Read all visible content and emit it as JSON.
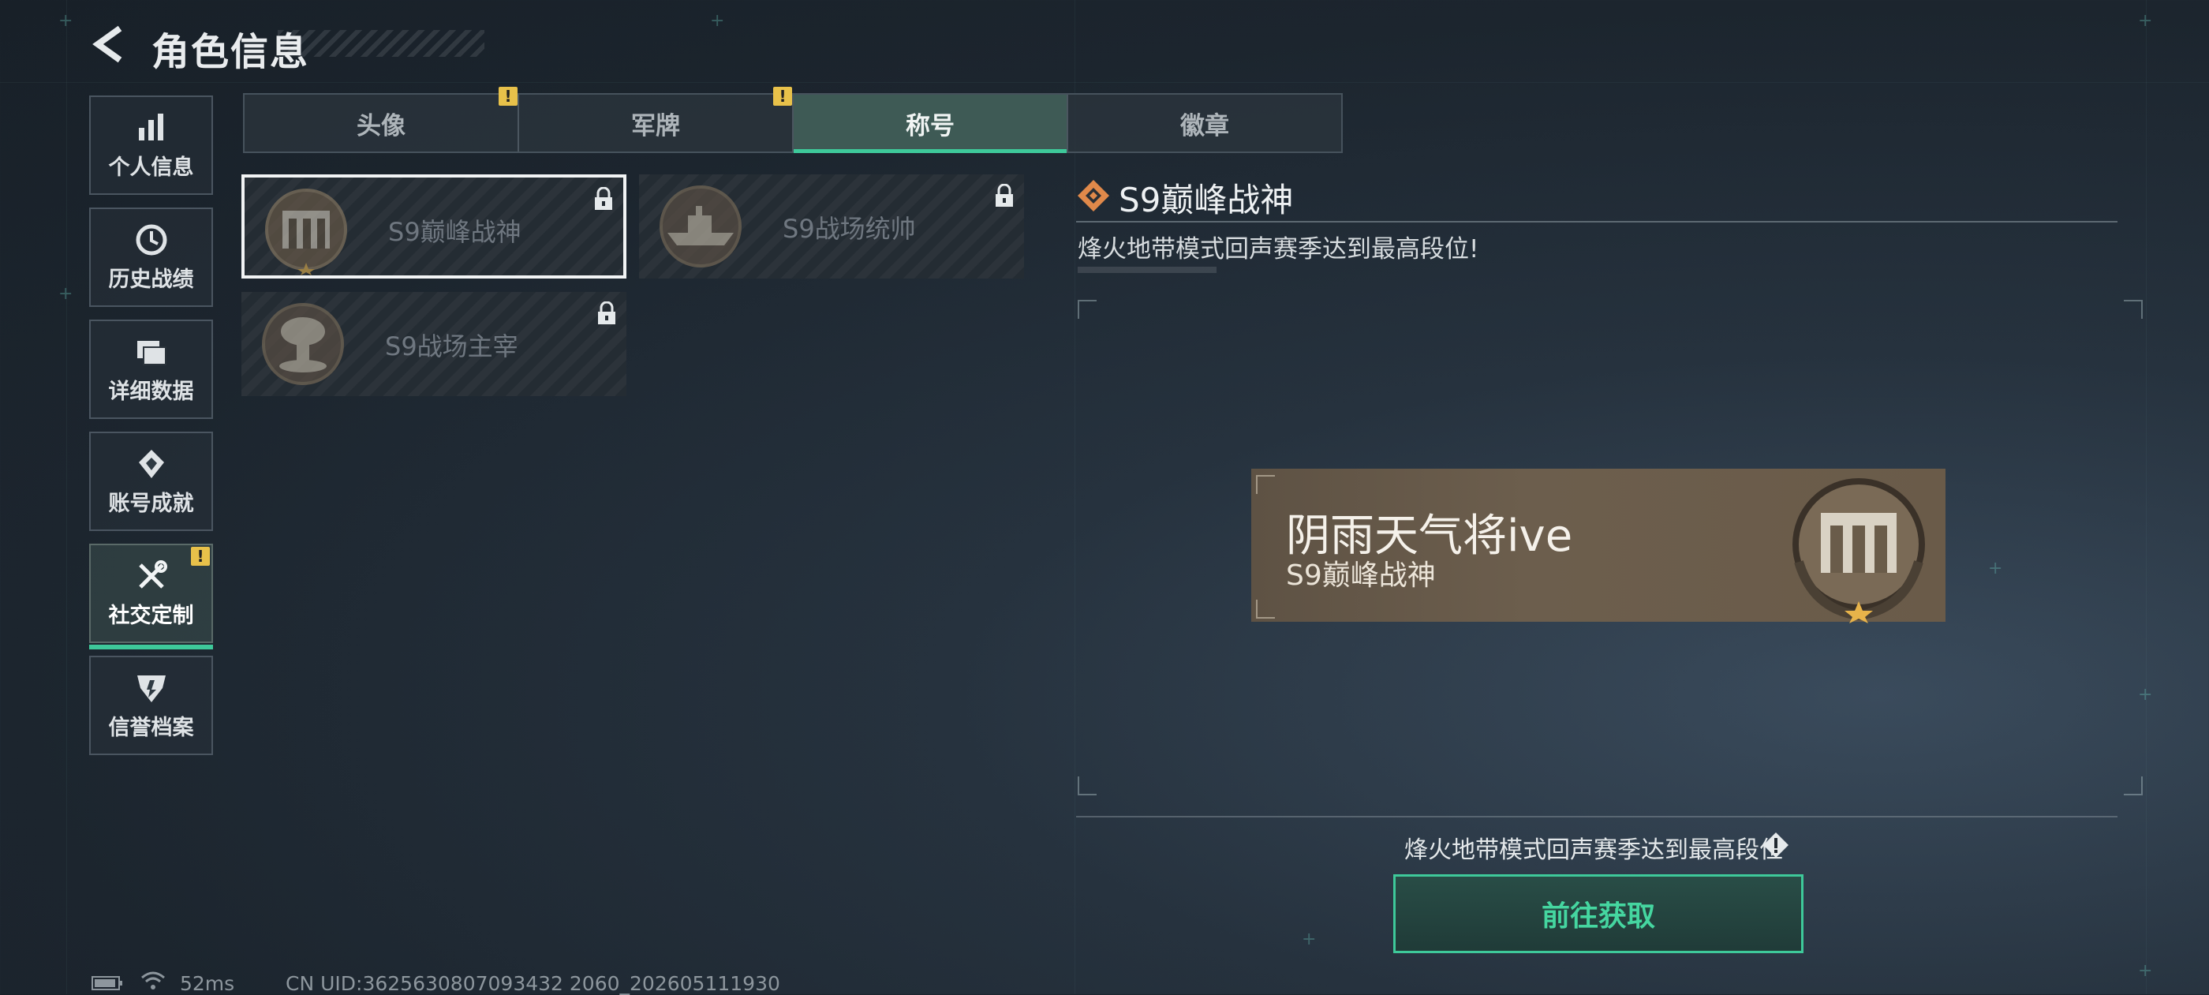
{
  "header": {
    "title": "角色信息"
  },
  "sidebar": {
    "items": [
      {
        "label": "个人信息",
        "icon": "bar-chart-icon"
      },
      {
        "label": "历史战绩",
        "icon": "clock-icon"
      },
      {
        "label": "详细数据",
        "icon": "folder-icon"
      },
      {
        "label": "账号成就",
        "icon": "achievement-icon"
      },
      {
        "label": "社交定制",
        "icon": "tools-icon",
        "active": true,
        "alert": "!"
      },
      {
        "label": "信誉档案",
        "icon": "badge-icon"
      }
    ]
  },
  "tabs": [
    {
      "label": "头像",
      "alert": "!"
    },
    {
      "label": "军牌",
      "alert": "!"
    },
    {
      "label": "称号",
      "active": true
    },
    {
      "label": "徽章"
    }
  ],
  "titles": [
    {
      "name": "S9巅峰战神",
      "selected": true,
      "locked": true
    },
    {
      "name": "S9战场统帅",
      "locked": true
    },
    {
      "name": "S9战场主宰",
      "locked": true
    }
  ],
  "detail": {
    "title": "S9巅峰战神",
    "description": "烽火地带模式回声赛季达到最高段位!",
    "preview": {
      "player_name": "阴雨天气将ive",
      "title": "S9巅峰战神"
    },
    "condition": "烽火地带模式回声赛季达到最高段位",
    "action_label": "前往获取"
  },
  "status": {
    "ping": "52ms",
    "uid": "CN UID:3625630807093432 2060_202605111930"
  },
  "colors": {
    "accent": "#3ec99a",
    "warning": "#e8c14a",
    "title_icon": "#e0894a"
  }
}
